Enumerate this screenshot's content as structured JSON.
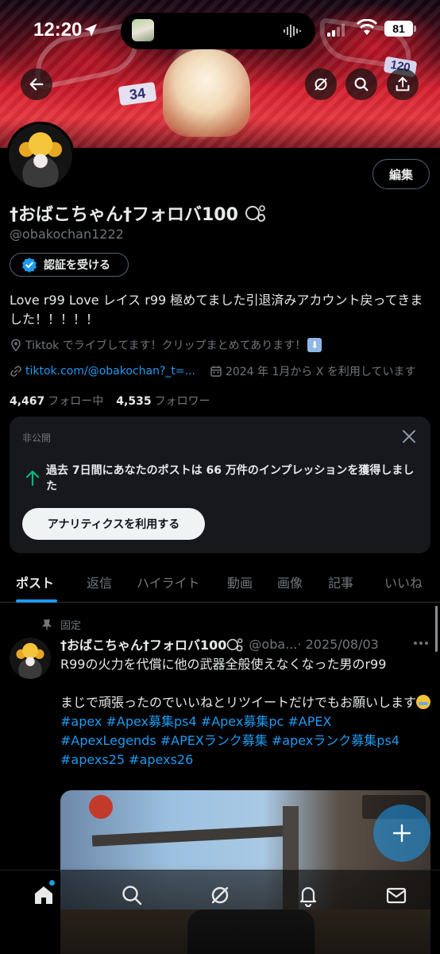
{
  "status_bar": {
    "time": "12:20",
    "battery": "81"
  },
  "profile": {
    "edit_label": "編集",
    "display_name": "†おばこちゃん†フォロバ100",
    "handle": "@obakochan1222",
    "verify_label": "認証を受ける",
    "bio": "Love r99 Love レイス r99 極めてました引退済みアカウント戻ってきました！！！！！",
    "location": "Tiktok でライブしてます！クリップまとめてあります！",
    "website": "tiktok.com/@obakochan?_t=...",
    "joined": "2024 年 1月から X を利用しています",
    "following_count": "4,467",
    "following_label": "フォロー中",
    "followers_count": "4,535",
    "followers_label": "フォロワー"
  },
  "analytics_card": {
    "private_label": "非公開",
    "message": "過去 7日間にあなたのポストは 66 万件のインプレッションを獲得しました",
    "button_label": "アナリティクスを利用する"
  },
  "tabs": [
    {
      "label": "ポスト",
      "active": true
    },
    {
      "label": "返信"
    },
    {
      "label": "ハイライト"
    },
    {
      "label": "動画"
    },
    {
      "label": "画像"
    },
    {
      "label": "記事"
    },
    {
      "label": "いいね"
    }
  ],
  "post": {
    "pinned_label": "固定",
    "author_name": "†おばこちゃん†フォロバ100",
    "author_handle": "@oba...",
    "date": "· 2025/08/03",
    "line1": "R99の火力を代償に他の武器全般使えなくなった男のr99",
    "line2": "まじで頑張ったのでいいねとリツイートだけでもお願いします",
    "hashtags_line1": "#apex #Apex募集ps4 #Apex募集pc #APEX",
    "hashtags_line2": "#ApexLegends #APEXランク募集 #apexランク募集ps4",
    "hashtags_line3": "#apexs25 #apexs26"
  },
  "colors": {
    "accent": "#1d9bf0",
    "background": "#000000",
    "card": "#16181c",
    "muted_text": "#71767b",
    "success_arrow": "#00ba7c"
  },
  "icons": {
    "back": "arrow-left-icon",
    "grok": "grok-icon",
    "search": "search-icon",
    "share": "share-icon",
    "verified": "verified-badge-icon",
    "location": "location-pin-icon",
    "link": "link-icon",
    "calendar": "calendar-icon",
    "close": "close-icon",
    "trend": "arrow-up-icon",
    "pin": "pin-icon",
    "compose": "plus-icon",
    "nav": [
      "home-icon",
      "search-icon",
      "grok-icon",
      "bell-icon",
      "mail-icon"
    ]
  }
}
